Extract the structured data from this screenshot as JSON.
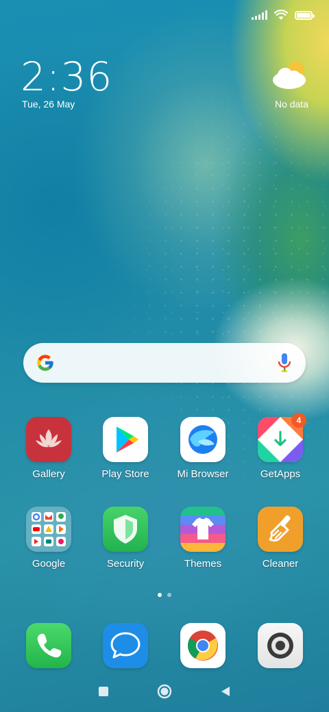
{
  "status_bar": {
    "icons": [
      "signal-icon",
      "wifi-icon",
      "battery-icon"
    ],
    "battery_level": 1.0
  },
  "clock": {
    "time": "2:36",
    "date": "Tue, 26 May"
  },
  "weather": {
    "icon": "partly-cloudy-icon",
    "text": "No data"
  },
  "search": {
    "left_icon": "google-g-icon",
    "right_icon": "microphone-icon"
  },
  "apps": [
    {
      "label": "Gallery",
      "icon": "gallery-icon"
    },
    {
      "label": "Play Store",
      "icon": "play-store-icon"
    },
    {
      "label": "Mi Browser",
      "icon": "mi-browser-icon"
    },
    {
      "label": "GetApps",
      "icon": "getapps-icon",
      "badge": "4"
    },
    {
      "label": "Google",
      "icon": "google-folder-icon"
    },
    {
      "label": "Security",
      "icon": "security-icon"
    },
    {
      "label": "Themes",
      "icon": "themes-icon"
    },
    {
      "label": "Cleaner",
      "icon": "cleaner-icon"
    }
  ],
  "page_indicator": {
    "pages": 2,
    "current": 1
  },
  "dock": [
    {
      "icon": "phone-icon"
    },
    {
      "icon": "messages-icon"
    },
    {
      "icon": "chrome-icon"
    },
    {
      "icon": "camera-icon"
    }
  ],
  "nav_bar": [
    "recents-square-icon",
    "home-circle-icon",
    "back-triangle-icon"
  ],
  "colors": {
    "badge": "#f05a28",
    "gallery": "#c8323c",
    "security": "#2fbf5a",
    "cleaner": "#f0a02a",
    "phone": "#33c35a",
    "messages": "#1d8de8"
  }
}
